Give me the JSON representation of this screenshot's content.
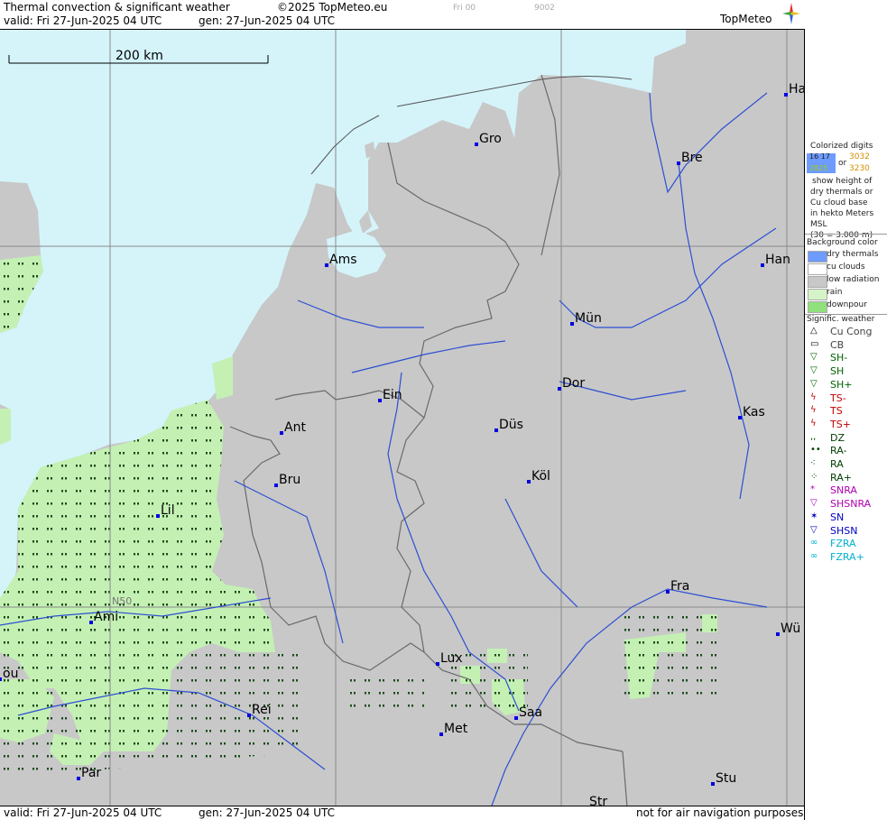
{
  "header": {
    "title": "Thermal convection & significant weather",
    "copyright": "©2025 TopMeteo.eu",
    "run": "Fri 00",
    "code": "9002",
    "valid": "valid:  Fri  27-Jun-2025  04 UTC",
    "gen": "gen:  27-Jun-2025 04 UTC",
    "logo": "TopMeteo"
  },
  "footer": {
    "valid": "valid:  Fri  27-Jun-2025  04 UTC",
    "gen": "gen:  27-Jun-2025 04 UTC",
    "note": "not for air navigation purposes"
  },
  "map": {
    "scale_label": "200 km",
    "lat_label": "N50",
    "colors": {
      "sea": "#d4f4fa",
      "land": "#c8c8c8",
      "rain": "#c4f0b4",
      "border": "#707070",
      "river": "#2d4fd2"
    },
    "cities": [
      {
        "label": "Gro"
      },
      {
        "label": "Bre"
      },
      {
        "label": "Ha"
      },
      {
        "label": "Ams"
      },
      {
        "label": "Han"
      },
      {
        "label": "Mün"
      },
      {
        "label": "Ein"
      },
      {
        "label": "Dor"
      },
      {
        "label": "Kas"
      },
      {
        "label": "Ant"
      },
      {
        "label": "Düs"
      },
      {
        "label": "Bru"
      },
      {
        "label": "Köl"
      },
      {
        "label": "Lil"
      },
      {
        "label": "Fra"
      },
      {
        "label": "Ami"
      },
      {
        "label": "Wü"
      },
      {
        "label": "Lux"
      },
      {
        "label": "ou"
      },
      {
        "label": "Saa"
      },
      {
        "label": "Rei"
      },
      {
        "label": "Met"
      },
      {
        "label": "Par"
      },
      {
        "label": "Stu"
      },
      {
        "label": "Str"
      }
    ]
  },
  "legend": {
    "colorized": [
      "Colorized digits",
      "show height of",
      "dry thermals or",
      "Cu cloud base",
      "in hekto Meters",
      "MSL",
      "(30 = 3.000 m)"
    ],
    "digits": {
      "a": "16 17",
      "b": "2825",
      "or": "or",
      "c": "3032",
      "d": "3230"
    },
    "background_title": "Background color",
    "background": [
      {
        "label": "dry thermals",
        "color": "#6e9bff"
      },
      {
        "label": "cu clouds",
        "color": "#ffffff"
      },
      {
        "label": "low radiation",
        "color": "#c8c8c8"
      },
      {
        "label": "rain",
        "color": "#d6f3c8"
      },
      {
        "label": "downpour",
        "color": "#90e07c"
      }
    ],
    "weather_title": "Signific. weather",
    "weather": [
      {
        "label": "Cu Cong",
        "icon": "cu-cong-icon",
        "color": "#000000"
      },
      {
        "label": "CB",
        "icon": "cb-icon",
        "color": "#000000"
      },
      {
        "label": "SH-",
        "icon": "shower-light-icon",
        "color": "#006400"
      },
      {
        "label": "SH",
        "icon": "shower-icon",
        "color": "#006400"
      },
      {
        "label": "SH+",
        "icon": "shower-heavy-icon",
        "color": "#006400"
      },
      {
        "label": "TS-",
        "icon": "thunder-light-icon",
        "color": "#c00000"
      },
      {
        "label": "TS",
        "icon": "thunder-icon",
        "color": "#c00000"
      },
      {
        "label": "TS+",
        "icon": "thunder-heavy-icon",
        "color": "#c00000"
      },
      {
        "label": "DZ",
        "icon": "drizzle-icon",
        "color": "#004000"
      },
      {
        "label": "RA-",
        "icon": "rain-light-icon",
        "color": "#004000"
      },
      {
        "label": "RA",
        "icon": "rain-icon",
        "color": "#004000"
      },
      {
        "label": "RA+",
        "icon": "rain-heavy-icon",
        "color": "#004000"
      },
      {
        "label": "SNRA",
        "icon": "sleet-icon",
        "color": "#b000b0"
      },
      {
        "label": "SHSNRA",
        "icon": "sleet-shower-icon",
        "color": "#b000b0"
      },
      {
        "label": "SN",
        "icon": "snow-icon",
        "color": "#0000c0"
      },
      {
        "label": "SHSN",
        "icon": "snow-shower-icon",
        "color": "#0000c0"
      },
      {
        "label": "FZRA",
        "icon": "freezing-rain-icon",
        "color": "#00b0d0"
      },
      {
        "label": "FZRA+",
        "icon": "freezing-rain-heavy-icon",
        "color": "#00b0d0"
      }
    ]
  }
}
